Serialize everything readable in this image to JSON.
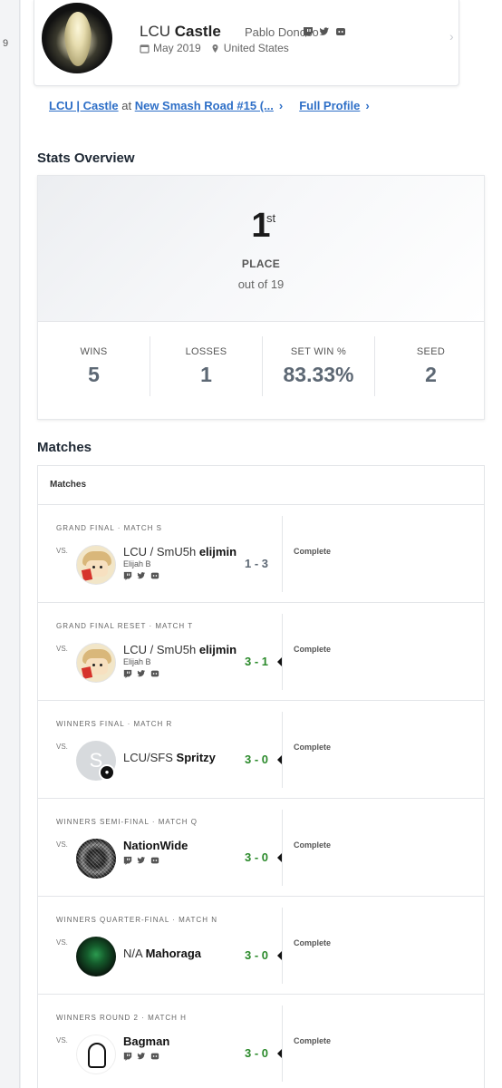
{
  "leftrail": {
    "text": "9"
  },
  "profile": {
    "prefix": "LCU",
    "gamertag": "Castle",
    "real_name": "Pablo Donoso",
    "joined": "May 2019",
    "location": "United States",
    "socials": [
      "twitch-icon",
      "twitter-icon",
      "discord-icon"
    ]
  },
  "links": {
    "event_player": "LCU | Castle",
    "event_at": "at",
    "event_name": "New Smash Road #15 (...",
    "full_profile": "Full Profile"
  },
  "stats_overview": {
    "title": "Stats Overview",
    "place": "1",
    "place_suffix": "st",
    "place_label": "PLACE",
    "out_of": "out of 19",
    "items": [
      {
        "label": "WINS",
        "value": "5"
      },
      {
        "label": "LOSSES",
        "value": "1"
      },
      {
        "label": "SET WIN %",
        "value": "83.33%"
      },
      {
        "label": "SEED",
        "value": "2"
      }
    ]
  },
  "matches": {
    "title": "Matches",
    "header": "Matches",
    "vs_label": "VS.",
    "list": [
      {
        "round": "GRAND FINAL · MATCH S",
        "prefix": "LCU / SmU5h",
        "tag": "elijmin",
        "sub": "Elijah B",
        "score": "1 - 3",
        "status": "Complete",
        "won": false,
        "avatar": "smush",
        "socials": true
      },
      {
        "round": "GRAND FINAL RESET · MATCH T",
        "prefix": "LCU / SmU5h",
        "tag": "elijmin",
        "sub": "Elijah B",
        "score": "3 - 1",
        "status": "Complete",
        "won": true,
        "avatar": "smush",
        "socials": true
      },
      {
        "round": "WINNERS FINAL · MATCH R",
        "prefix": "LCU/SFS",
        "tag": "Spritzy",
        "sub": "",
        "score": "3 - 0",
        "status": "Complete",
        "won": true,
        "avatar": "letter",
        "avatar_letter": "S",
        "socials": false
      },
      {
        "round": "WINNERS SEMI-FINAL · MATCH Q",
        "prefix": "",
        "tag": "NationWide",
        "sub": "",
        "score": "3 - 0",
        "status": "Complete",
        "won": true,
        "avatar": "noise",
        "socials": true
      },
      {
        "round": "WINNERS QUARTER-FINAL · MATCH N",
        "prefix": "N/A",
        "tag": "Mahoraga",
        "sub": "",
        "score": "3 - 0",
        "status": "Complete",
        "won": true,
        "avatar": "green",
        "socials": false
      },
      {
        "round": "WINNERS ROUND 2 · MATCH H",
        "prefix": "",
        "tag": "Bagman",
        "sub": "",
        "score": "3 - 0",
        "status": "Complete",
        "won": true,
        "avatar": "sketch",
        "socials": true
      }
    ]
  },
  "colors": {
    "link": "#2e6fc7",
    "win": "#2b8a2b",
    "muted": "#5d6874"
  }
}
